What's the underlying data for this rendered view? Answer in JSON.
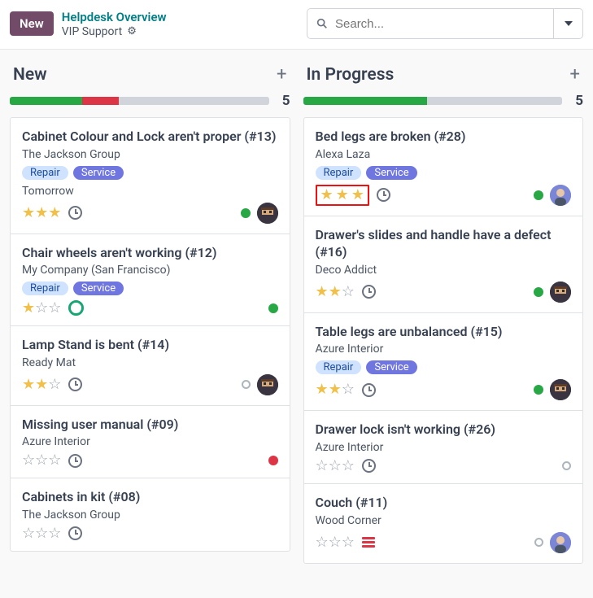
{
  "header": {
    "new_button": "New",
    "breadcrumb_top": "Helpdesk Overview",
    "breadcrumb_bottom": "VIP Support",
    "search_placeholder": "Search..."
  },
  "columns": [
    {
      "title": "New",
      "count": "5",
      "progress": [
        {
          "color": "green",
          "pct": 28
        },
        {
          "color": "red",
          "pct": 14
        },
        {
          "color": "grey",
          "pct": 58
        }
      ],
      "cards": [
        {
          "title": "Cabinet Colour and Lock aren't proper (#13)",
          "subtitle": "The Jackson Group",
          "tags": [
            "Repair",
            "Service"
          ],
          "date": "Tomorrow",
          "stars": 3,
          "after_stars_icon": "clock",
          "state": "green",
          "avatar": "pix"
        },
        {
          "title": "Chair wheels aren't working (#12)",
          "subtitle": "My Company (San Francisco)",
          "tags": [
            "Repair",
            "Service"
          ],
          "stars": 1,
          "after_stars_icon": "lifering",
          "state": "green"
        },
        {
          "title": "Lamp Stand is bent (#14)",
          "subtitle": "Ready Mat",
          "stars": 2,
          "after_stars_icon": "clock",
          "state": "hollow",
          "avatar": "pix"
        },
        {
          "title": "Missing user manual (#09)",
          "subtitle": "Azure Interior",
          "stars": 0,
          "after_stars_icon": "clock",
          "state": "red"
        },
        {
          "title": "Cabinets in kit (#08)",
          "subtitle": "The Jackson Group",
          "stars": 0,
          "after_stars_icon": "clock"
        }
      ]
    },
    {
      "title": "In Progress",
      "count": "5",
      "progress": [
        {
          "color": "green",
          "pct": 48
        },
        {
          "color": "grey",
          "pct": 52
        }
      ],
      "cards": [
        {
          "title": "Bed legs are broken (#28)",
          "subtitle": "Alexa Laza",
          "tags": [
            "Repair",
            "Service"
          ],
          "stars": 3,
          "stars_highlighted": true,
          "after_stars_icon": "clock",
          "state": "green",
          "avatar": "person"
        },
        {
          "title": "Drawer's slides and handle have a defect (#16)",
          "subtitle": "Deco Addict",
          "stars": 2,
          "after_stars_icon": "clock",
          "state": "green",
          "avatar": "pix"
        },
        {
          "title": "Table legs are unbalanced (#15)",
          "subtitle": "Azure Interior",
          "tags": [
            "Repair",
            "Service"
          ],
          "stars": 2,
          "after_stars_icon": "clock",
          "state": "green",
          "avatar": "pix"
        },
        {
          "title": "Drawer lock isn't working (#26)",
          "subtitle": "Azure Interior",
          "stars": 0,
          "after_stars_icon": "clock",
          "state": "hollow"
        },
        {
          "title": "Couch (#11)",
          "subtitle": "Wood Corner",
          "stars": 0,
          "after_stars_icon": "server",
          "state": "hollow",
          "avatar": "person"
        }
      ]
    }
  ]
}
